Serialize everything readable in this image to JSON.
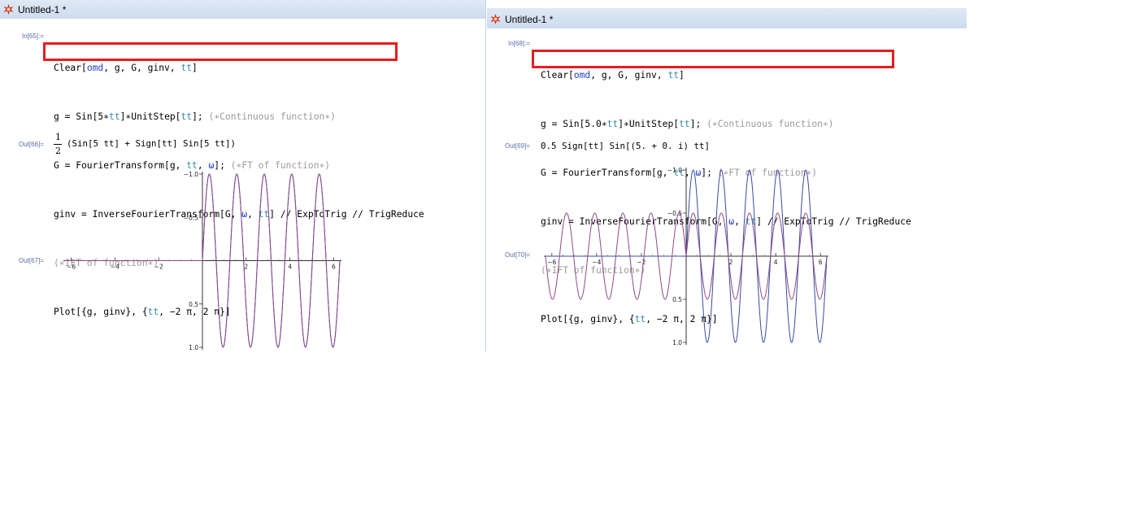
{
  "left": {
    "title": "Untitled-1 *",
    "in_label": "In[65]:=",
    "lines": {
      "clear": {
        "fn": "Clear[",
        "a1": "omd",
        "s1": ", g, G, ginv, ",
        "a2": "tt",
        "end": "]"
      },
      "g": {
        "p1": "g = Sin[5",
        "star": "∗",
        "v": "tt",
        "p2": "]",
        "star2": "∗",
        "p3": "UnitStep[",
        "v2": "tt",
        "p4": "]; ",
        "comment": "(∗Continuous function∗)"
      },
      "G": {
        "p1": "G = FourierTransform[g, ",
        "v": "tt",
        "p2": ", ",
        "w": "ω",
        "p3": "]; ",
        "comment": "(∗FT of function∗)"
      },
      "ginv": {
        "p1": "ginv = InverseFourierTransform[G, ",
        "w": "ω",
        "p2": ", ",
        "v": "tt",
        "p3": "] // ExpToTrig // TrigReduce"
      },
      "ift": {
        "comment": "(∗IFT of function∗)"
      },
      "plot": {
        "p1": "Plot[{g, ginv}, {",
        "v": "tt",
        "p2": ", −2 π, 2 π}]"
      }
    },
    "out1_label": "Out[66]=",
    "out1": {
      "num": "1",
      "den": "2",
      "expr": "(Sin[5 tt] + Sign[tt] Sin[5 tt])"
    },
    "out2_label": "Out[67]=",
    "plot": {
      "x_ticks": [
        "−6",
        "−4",
        "−2",
        "2",
        "4",
        "6"
      ],
      "y_ticks": [
        "1.0",
        "0.5",
        "−0.5",
        "−1.0"
      ]
    }
  },
  "right": {
    "title": "Untitled-1 *",
    "in_label": "In[68]:=",
    "lines": {
      "clear": {
        "fn": "Clear[",
        "a1": "omd",
        "s1": ", g, G, ginv, ",
        "a2": "tt",
        "end": "]"
      },
      "g": {
        "p1": "g = Sin[5.0",
        "star": "∗",
        "v": "tt",
        "p2": "]",
        "star2": "∗",
        "p3": "UnitStep[",
        "v2": "tt",
        "p4": "]; ",
        "comment": "(∗Continuous function∗)"
      },
      "G": {
        "p1": "G = FourierTransform[g, ",
        "v": "tt",
        "p2": ", ",
        "w": "ω",
        "p3": "]; ",
        "comment": "(∗FT of function∗)"
      },
      "ginv": {
        "p1": "ginv = InverseFourierTransform[G, ",
        "w": "ω",
        "p2": ", ",
        "v": "tt",
        "p3": "] // ExpToTrig // TrigReduce"
      },
      "ift": {
        "comment": "(∗IFT of function∗)"
      },
      "plot": {
        "p1": "Plot[{g, ginv}, {",
        "v": "tt",
        "p2": ", −2 π, 2 π}]"
      }
    },
    "out1_label": "Out[69]=",
    "out1": {
      "expr": "0.5 Sign[tt] Sin[(5. + 0. i) tt]"
    },
    "out2_label": "Out[70]=",
    "plot": {
      "x_ticks": [
        "−6",
        "−4",
        "−2",
        "2",
        "4",
        "6"
      ],
      "y_ticks": [
        "1.0",
        "0.5",
        "−0.5",
        "−1.0"
      ]
    }
  },
  "chart_data": [
    {
      "type": "line",
      "title": "",
      "xlim": [
        -6.2832,
        6.2832
      ],
      "ylim": [
        -1.0,
        1.0
      ],
      "x_ticks": [
        -6,
        -4,
        -2,
        2,
        4,
        6
      ],
      "y_ticks": [
        -1.0,
        -0.5,
        0.5,
        1.0
      ],
      "series": [
        {
          "function": "Sin[5 tt] UnitStep[tt]",
          "color": "#3b4a9e"
        },
        {
          "function": "(Sin[5 tt] + Sign[tt] Sin[5 tt]) / 2",
          "color": "#8a4a8c"
        }
      ]
    },
    {
      "type": "line",
      "title": "",
      "xlim": [
        -6.2832,
        6.2832
      ],
      "ylim": [
        -1.0,
        1.0
      ],
      "x_ticks": [
        -6,
        -4,
        -2,
        2,
        4,
        6
      ],
      "y_ticks": [
        -1.0,
        -0.5,
        0.5,
        1.0
      ],
      "series": [
        {
          "function": "Sin[5.0 tt] UnitStep[tt]",
          "color": "#3b4a9e"
        },
        {
          "function": "0.5 Sign[tt] Sin[5 tt]",
          "color": "#8a4a8c"
        }
      ]
    }
  ],
  "colors": {
    "highlight": "#e21d23",
    "symbol_blue": "#1f3fbf",
    "variable_teal": "#2f8aa8",
    "comment_gray": "#9a9a9a",
    "label_blue": "#5b6fa8"
  },
  "icons": {
    "app_icon": "mathematica-spikey-icon"
  }
}
